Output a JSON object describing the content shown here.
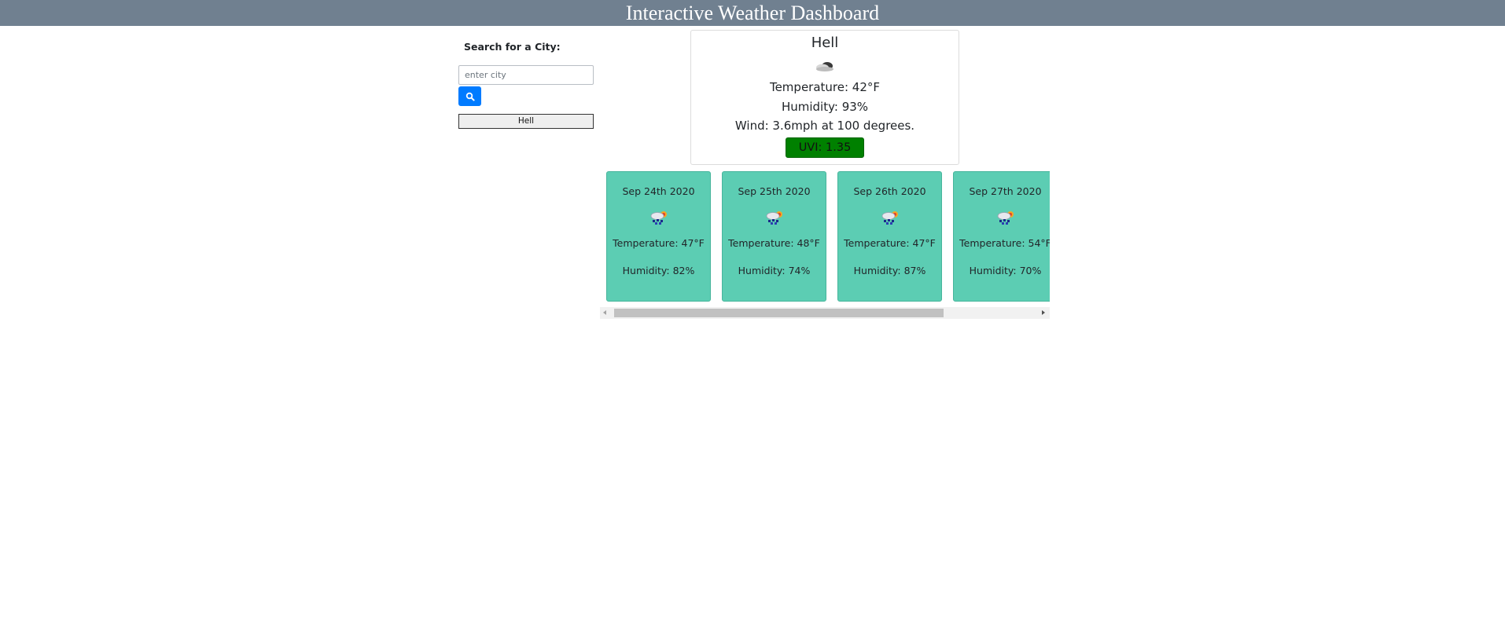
{
  "header": {
    "title": "Interactive Weather Dashboard"
  },
  "search": {
    "label": "Search for a City:",
    "placeholder": "enter city",
    "button_icon": "search-icon"
  },
  "history": [
    {
      "label": "Hell"
    }
  ],
  "current": {
    "city": "Hell",
    "icon": "cloudy-icon",
    "temperature": "Temperature: 42°F",
    "humidity": "Humidity: 93%",
    "wind": "Wind: 3.6mph at 100 degrees.",
    "uvi": "UVI: 1.35"
  },
  "forecast": [
    {
      "date": "Sep 24th 2020",
      "icon": "rain-snow-sun-icon",
      "temperature": "Temperature: 47°F",
      "humidity": "Humidity: 82%"
    },
    {
      "date": "Sep 25th 2020",
      "icon": "rain-snow-sun-icon",
      "temperature": "Temperature: 48°F",
      "humidity": "Humidity: 74%"
    },
    {
      "date": "Sep 26th 2020",
      "icon": "rain-snow-sun-icon",
      "temperature": "Temperature: 47°F",
      "humidity": "Humidity: 87%"
    },
    {
      "date": "Sep 27th 2020",
      "icon": "rain-snow-sun-icon",
      "temperature": "Temperature: 54°F",
      "humidity": "Humidity: 70%"
    }
  ],
  "colors": {
    "header_bg": "#708090",
    "search_button": "#007bff",
    "uvi_badge": "#008000",
    "forecast_card": "#5ccdb3"
  }
}
